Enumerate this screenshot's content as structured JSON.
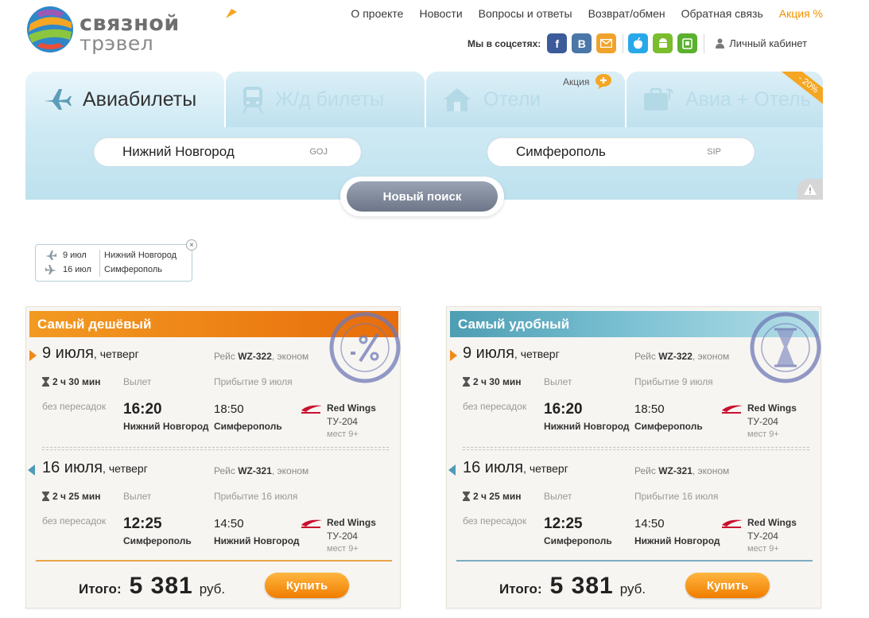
{
  "brand": {
    "name": "связной",
    "sub": "трэвел"
  },
  "nav": {
    "items": [
      "О проекте",
      "Новости",
      "Вопросы и ответы",
      "Возврат/обмен",
      "Обратная связь"
    ],
    "promo": "Акция %"
  },
  "social": {
    "label": "Мы в соцсетях:",
    "fb": "f",
    "vk": "B",
    "cabinet": "Личный кабинет"
  },
  "tabs": [
    {
      "label": "Авиабилеты",
      "icon": "airplane-icon"
    },
    {
      "label": "Ж/д билеты",
      "icon": "train-icon"
    },
    {
      "label": "Отели",
      "icon": "house-icon"
    },
    {
      "label": "Авиа + Отель",
      "icon": "suitcase-icon"
    }
  ],
  "tab_promo": "Акция",
  "ribbon": "- 20%",
  "search": {
    "from_city": "Нижний Новгород",
    "from_code": "GOJ",
    "to_city": "Симферополь",
    "to_code": "SIP",
    "button": "Новый поиск"
  },
  "summary": {
    "out_date": "9 июл",
    "back_date": "16 июл",
    "from": "Нижний Новгород",
    "to": "Симферополь",
    "close": "×"
  },
  "cards": [
    {
      "title": "Самый дешёвый",
      "accent": "#f0891a",
      "legs": [
        {
          "day": "9 июля",
          "weekday": ", четверг",
          "flight_prefix": "Рейс ",
          "flight": "WZ-322",
          "class": ", эконом",
          "duration": "2 ч 30 мин",
          "dep_label": "Вылет",
          "arr_label": "Прибытие 9 июля",
          "stops": "без пересадок",
          "dep_time": "16:20",
          "dep_city": "Нижний Новгород",
          "arr_time": "18:50",
          "arr_city": "Симферополь",
          "airline": "Red Wings",
          "plane": "ТУ-204",
          "seats": "мест 9+"
        },
        {
          "day": "16 июля",
          "weekday": ", четверг",
          "flight_prefix": "Рейс ",
          "flight": "WZ-321",
          "class": ", эконом",
          "duration": "2 ч 25 мин",
          "dep_label": "Вылет",
          "arr_label": "Прибытие 16 июля",
          "stops": "без пересадок",
          "dep_time": "12:25",
          "dep_city": "Симферополь",
          "arr_time": "14:50",
          "arr_city": "Нижний Новгород",
          "airline": "Red Wings",
          "plane": "ТУ-204",
          "seats": "мест 9+"
        }
      ],
      "total_label": "Итого:",
      "total": "5 381",
      "currency": "руб.",
      "buy": "Купить"
    },
    {
      "title": "Самый удобный",
      "accent": "#4f9bb8",
      "legs": [
        {
          "day": "9 июля",
          "weekday": ", четверг",
          "flight_prefix": "Рейс ",
          "flight": "WZ-322",
          "class": ", эконом",
          "duration": "2 ч 30 мин",
          "dep_label": "Вылет",
          "arr_label": "Прибытие 9 июля",
          "stops": "без пересадок",
          "dep_time": "16:20",
          "dep_city": "Нижний Новгород",
          "arr_time": "18:50",
          "arr_city": "Симферополь",
          "airline": "Red Wings",
          "plane": "ТУ-204",
          "seats": "мест 9+"
        },
        {
          "day": "16 июля",
          "weekday": ", четверг",
          "flight_prefix": "Рейс ",
          "flight": "WZ-321",
          "class": ", эконом",
          "duration": "2 ч 25 мин",
          "dep_label": "Вылет",
          "arr_label": "Прибытие 16 июля",
          "stops": "без пересадок",
          "dep_time": "12:25",
          "dep_city": "Симферополь",
          "arr_time": "14:50",
          "arr_city": "Нижний Новгород",
          "airline": "Red Wings",
          "plane": "ТУ-204",
          "seats": "мест 9+"
        }
      ],
      "total_label": "Итого:",
      "total": "5 381",
      "currency": "руб.",
      "buy": "Купить"
    }
  ]
}
